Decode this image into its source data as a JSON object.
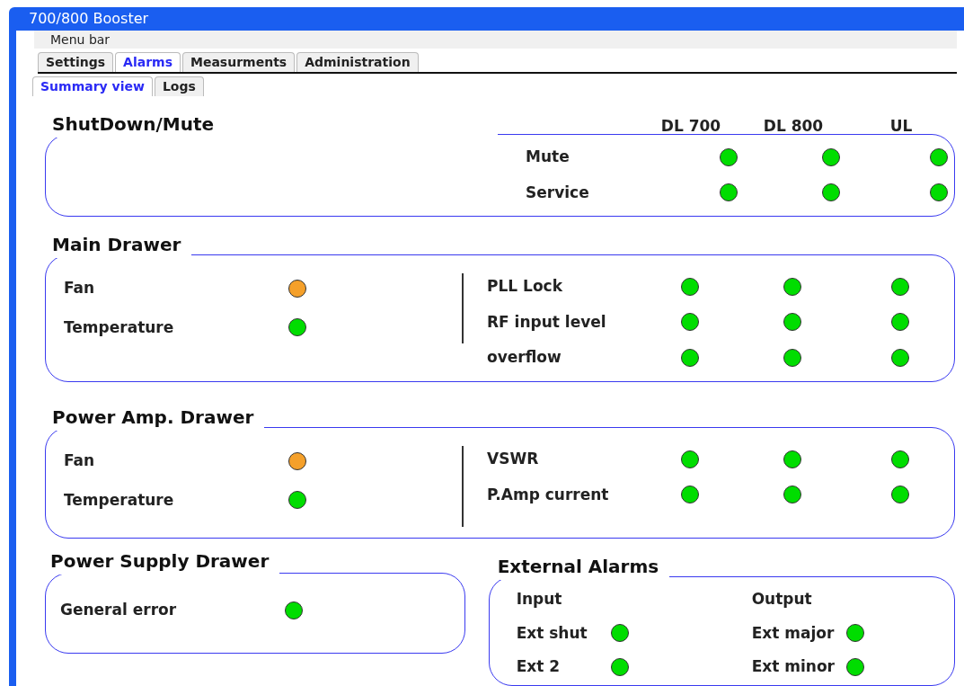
{
  "window": {
    "title": "700/800 Booster"
  },
  "menu_bar": {
    "label": "Menu bar"
  },
  "tabs": [
    {
      "label": "Settings",
      "selected": false
    },
    {
      "label": "Alarms",
      "selected": true
    },
    {
      "label": "Measurments",
      "selected": false
    },
    {
      "label": "Administration",
      "selected": false
    }
  ],
  "subtabs": [
    {
      "label": "Summary view",
      "selected": true
    },
    {
      "label": "Logs",
      "selected": false
    }
  ],
  "shutdown": {
    "title": "ShutDown/Mute",
    "columns": [
      "DL 700",
      "DL 800",
      "UL"
    ],
    "rows": [
      {
        "label": "Mute",
        "lights": [
          {
            "color": "#00dd00"
          },
          {
            "color": "#00dd00"
          },
          {
            "color": "#00dd00"
          }
        ]
      },
      {
        "label": "Service",
        "lights": [
          {
            "color": "#00dd00"
          },
          {
            "color": "#00dd00"
          },
          {
            "color": "#00dd00"
          }
        ]
      }
    ]
  },
  "main_drawer": {
    "title": "Main Drawer",
    "left_rows": [
      {
        "label": "Fan",
        "color": "#f5a02a"
      },
      {
        "label": "Temperature",
        "color": "#00dd00"
      }
    ],
    "right_rows": [
      {
        "label": "PLL Lock",
        "lights": [
          {
            "color": "#00dd00"
          },
          {
            "color": "#00dd00"
          },
          {
            "color": "#00dd00"
          }
        ]
      },
      {
        "label": "RF input level",
        "lights": [
          {
            "color": "#00dd00"
          },
          {
            "color": "#00dd00"
          },
          {
            "color": "#00dd00"
          }
        ]
      },
      {
        "label": "overflow",
        "lights": [
          {
            "color": "#00dd00"
          },
          {
            "color": "#00dd00"
          },
          {
            "color": "#00dd00"
          }
        ]
      }
    ]
  },
  "power_amp_drawer": {
    "title": "Power Amp. Drawer",
    "left_rows": [
      {
        "label": "Fan",
        "color": "#f5a02a"
      },
      {
        "label": "Temperature",
        "color": "#00dd00"
      }
    ],
    "right_rows": [
      {
        "label": "VSWR",
        "lights": [
          {
            "color": "#00dd00"
          },
          {
            "color": "#00dd00"
          },
          {
            "color": "#00dd00"
          }
        ]
      },
      {
        "label": "P.Amp current",
        "lights": [
          {
            "color": "#00dd00"
          },
          {
            "color": "#00dd00"
          },
          {
            "color": "#00dd00"
          }
        ]
      }
    ]
  },
  "power_supply_drawer": {
    "title": "Power Supply Drawer",
    "rows": [
      {
        "label": "General error",
        "color": "#00dd00"
      }
    ]
  },
  "external_alarms": {
    "title": "External Alarms",
    "input": {
      "heading": "Input",
      "rows": [
        {
          "label": "Ext shut",
          "color": "#00dd00"
        },
        {
          "label": "Ext 2",
          "color": "#00dd00"
        }
      ]
    },
    "output": {
      "heading": "Output",
      "rows": [
        {
          "label": "Ext major",
          "color": "#00dd00"
        },
        {
          "label": "Ext minor",
          "color": "#00dd00"
        }
      ]
    }
  }
}
